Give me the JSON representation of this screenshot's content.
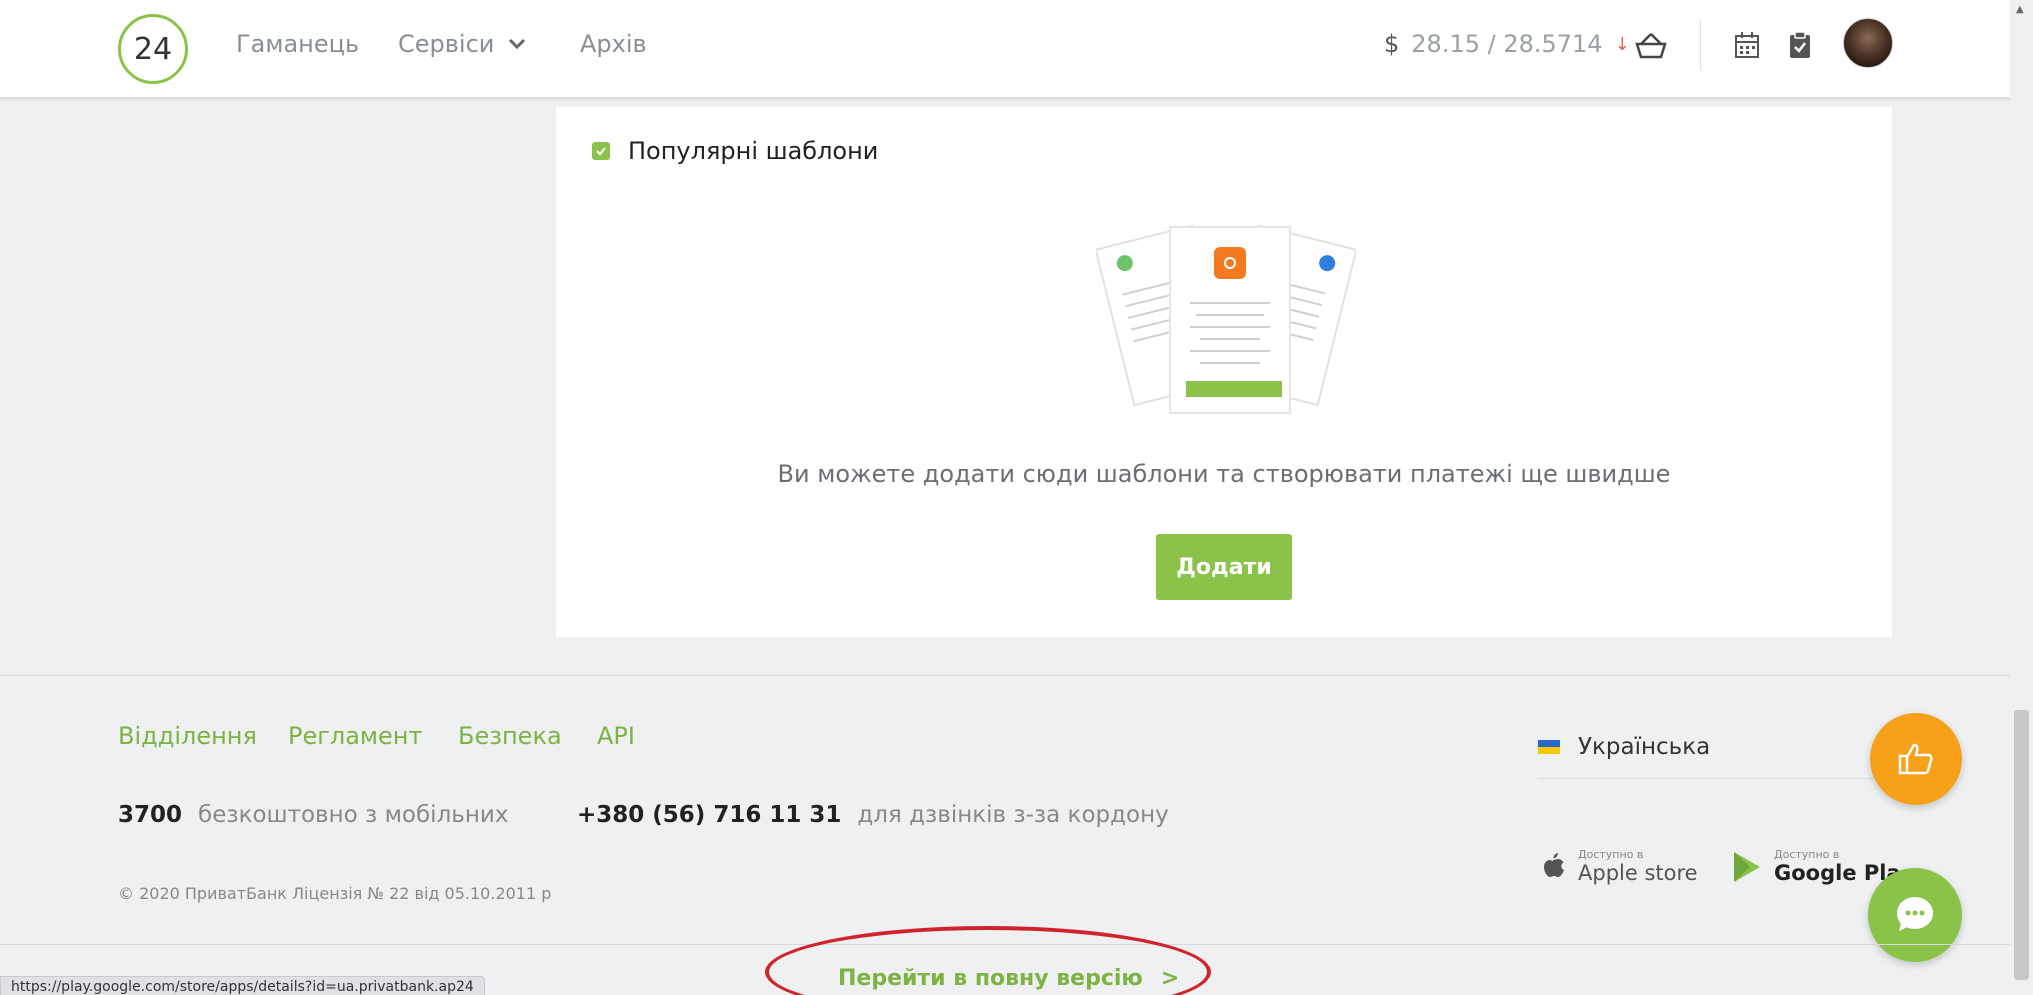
{
  "header": {
    "logo_text": "24",
    "nav": {
      "wallet": "Гаманець",
      "services": "Сервіси",
      "archive": "Архів"
    },
    "rate": {
      "currency_symbol": "$",
      "value": "28.15 / 28.5714",
      "trend_icon": "arrow-down-icon"
    },
    "icons": [
      "basket-icon",
      "calendar-icon",
      "clipboard-icon",
      "avatar"
    ]
  },
  "templates": {
    "title": "Популярні шаблони",
    "empty_message": "Ви можете додати сюди шаблони та створювати платежі ще швидше",
    "add_button": "Додати"
  },
  "footer": {
    "links": [
      "Відділення",
      "Регламент",
      "Безпека",
      "API"
    ],
    "phone_short": "3700",
    "phone_short_desc": "безкоштовно з мобільних",
    "phone_long": "+380 (56) 716 11 31",
    "phone_long_desc": "для дзвінків з-за кордону",
    "copyright": "© 2020 ПриватБанк Ліцензія № 22 від 05.10.2011 р",
    "language": "Українська",
    "stores": {
      "apple_small": "Доступно в",
      "apple_big": "Apple store",
      "google_small": "Доступно в",
      "google_big": "Google Pla"
    }
  },
  "bottom": {
    "full_version": "Перейти в повну версію",
    "status_url": "https://play.google.com/store/apps/details?id=ua.privatbank.ap24"
  },
  "colors": {
    "accent_green": "#8bc34a",
    "link_green": "#7cb342",
    "orange": "#f7a11a",
    "annotation_red": "#d0242b"
  }
}
